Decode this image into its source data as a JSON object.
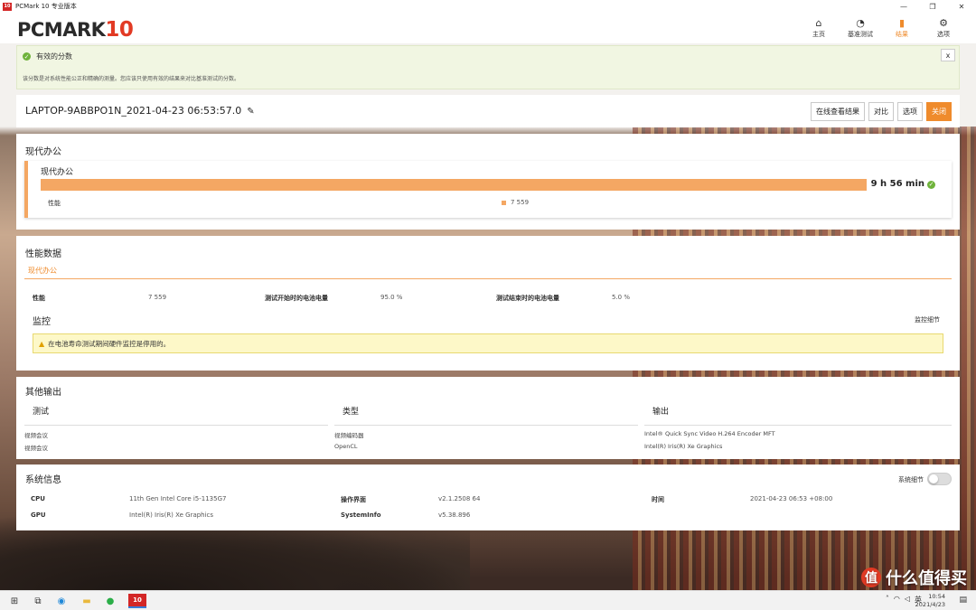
{
  "window": {
    "title": "PCMark 10 专业版本",
    "app_icon": "10"
  },
  "header": {
    "logo_main": "PCMARK",
    "logo_num": "10",
    "nav": [
      {
        "label": "主页",
        "icon": "home-icon",
        "glyph": "⌂"
      },
      {
        "label": "基准测试",
        "icon": "gauge-icon",
        "glyph": "◔"
      },
      {
        "label": "结果",
        "icon": "bar-chart-icon",
        "glyph": "▮"
      },
      {
        "label": "选项",
        "icon": "gear-icon",
        "glyph": "⚙"
      }
    ],
    "active_nav": "结果",
    "accent": "#ef8b2c"
  },
  "valid_banner": {
    "title": "有效的分数",
    "desc": "该分数是对系统性能公正和精确的测量。您应该只使用有效的结果来对比基准测试的分数。",
    "close": "x"
  },
  "result": {
    "name": "LAPTOP-9ABBPO1N_2021-04-23 06:53:57.0",
    "buttons": {
      "online": "在线查看结果",
      "compare": "对比",
      "options": "选项",
      "close": "关闭"
    }
  },
  "office": {
    "section_title": "现代办公",
    "card_title": "现代办公",
    "duration": "9 h 56 min",
    "perf_label": "性能",
    "perf_value": "7 559",
    "bar_color": "#f4a763"
  },
  "perf_data": {
    "section_title": "性能数据",
    "tab": "现代办公",
    "items": [
      {
        "k": "性能",
        "v": "7 559"
      },
      {
        "k": "测试开始时的电池电量",
        "v": "95.0 %"
      },
      {
        "k": "测试结束时的电池电量",
        "v": "5.0 %"
      }
    ],
    "monitor_title": "监控",
    "monitor_detail": "监控细节",
    "warning": "在电池寿命测试期间硬件监控是停用的。"
  },
  "other_output": {
    "section_title": "其他输出",
    "headers": [
      "测试",
      "类型",
      "输出"
    ],
    "rows": [
      [
        "视频会议",
        "视频编码器",
        "Intel® Quick Sync Video H.264 Encoder MFT"
      ],
      [
        "视频会议",
        "OpenCL",
        "Intel(R) Iris(R) Xe Graphics"
      ]
    ]
  },
  "system_info": {
    "section_title": "系统信息",
    "toggle_label": "系统细节",
    "rows": [
      {
        "k1": "CPU",
        "v1": "11th Gen Intel Core i5-1135G7",
        "k2": "操作界面",
        "v2": "v2.1.2508 64",
        "k3": "时间",
        "v3": "2021-04-23 06:53 +08:00"
      },
      {
        "k1": "GPU",
        "v1": "Intel(R) Iris(R) Xe Graphics",
        "k2": "SystemInfo",
        "v2": "v5.38.896",
        "k3": "",
        "v3": ""
      }
    ]
  },
  "taskbar": {
    "pinned_pcm": "10",
    "tray_lang": "英",
    "time": "10:54",
    "date": "2021/4/23"
  },
  "watermark": {
    "text": "什么值得买",
    "icon": "值"
  }
}
